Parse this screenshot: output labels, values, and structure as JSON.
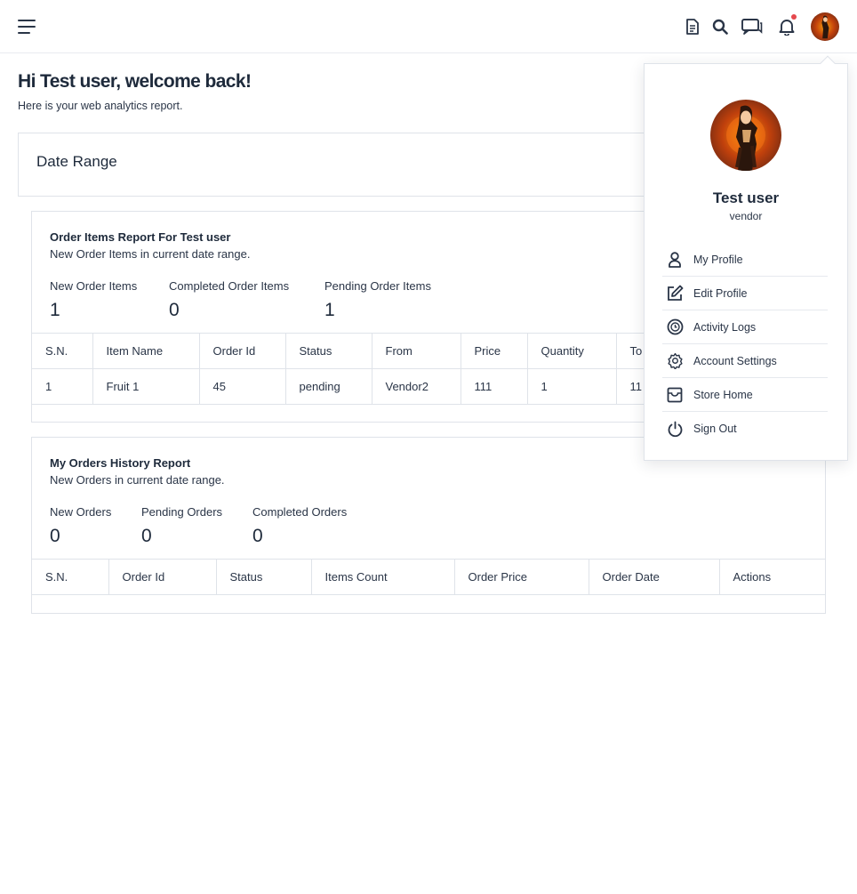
{
  "header": {
    "icons": [
      "document-icon",
      "search-icon",
      "chat-icon",
      "bell-icon",
      "avatar"
    ],
    "notification_dot_color": "#e5484d"
  },
  "welcome": {
    "title": "Hi Test user, welcome back!",
    "subtitle": "Here is your web analytics report."
  },
  "date_range": {
    "label": "Date Range"
  },
  "order_items_report": {
    "title": "Order Items Report For Test user",
    "subtitle": "New Order Items in current date range.",
    "stats": [
      {
        "label": "New Order Items",
        "value": "1"
      },
      {
        "label": "Completed Order Items",
        "value": "0"
      },
      {
        "label": "Pending Order Items",
        "value": "1"
      }
    ],
    "columns": [
      "S.N.",
      "Item Name",
      "Order Id",
      "Status",
      "From",
      "Price",
      "Quantity",
      "To"
    ],
    "rows": [
      [
        "1",
        "Fruit 1",
        "45",
        "pending",
        "Vendor2",
        "111",
        "1",
        "11"
      ]
    ]
  },
  "orders_history_report": {
    "title": "My Orders History Report",
    "subtitle": "New Orders in current date range.",
    "stats": [
      {
        "label": "New Orders",
        "value": "0"
      },
      {
        "label": "Pending Orders",
        "value": "0"
      },
      {
        "label": "Completed Orders",
        "value": "0"
      }
    ],
    "columns": [
      "S.N.",
      "Order Id",
      "Status",
      "Items Count",
      "Order Price",
      "Order Date",
      "Actions"
    ]
  },
  "profile_dropdown": {
    "name": "Test user",
    "role": "vendor",
    "menu": [
      {
        "label": "My Profile",
        "icon": "user-icon"
      },
      {
        "label": "Edit Profile",
        "icon": "edit-icon"
      },
      {
        "label": "Activity Logs",
        "icon": "clock-icon"
      },
      {
        "label": "Account Settings",
        "icon": "gear-icon"
      },
      {
        "label": "Store Home",
        "icon": "store-icon"
      },
      {
        "label": "Sign Out",
        "icon": "power-icon"
      }
    ]
  },
  "colors": {
    "text_dark": "#1e2a3b",
    "border": "#dfe3e9",
    "avatar_orange": "#c2410c"
  }
}
